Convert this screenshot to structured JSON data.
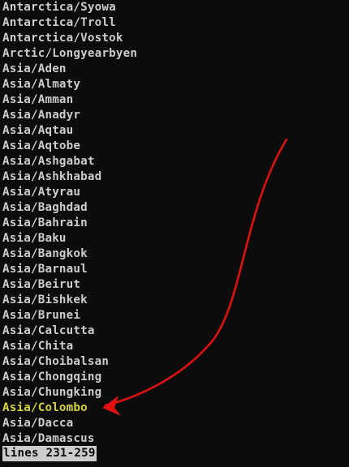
{
  "terminal": {
    "lines": [
      "Antarctica/Syowa",
      "Antarctica/Troll",
      "Antarctica/Vostok",
      "Arctic/Longyearbyen",
      "Asia/Aden",
      "Asia/Almaty",
      "Asia/Amman",
      "Asia/Anadyr",
      "Asia/Aqtau",
      "Asia/Aqtobe",
      "Asia/Ashgabat",
      "Asia/Ashkhabad",
      "Asia/Atyrau",
      "Asia/Baghdad",
      "Asia/Bahrain",
      "Asia/Baku",
      "Asia/Bangkok",
      "Asia/Barnaul",
      "Asia/Beirut",
      "Asia/Bishkek",
      "Asia/Brunei",
      "Asia/Calcutta",
      "Asia/Chita",
      "Asia/Choibalsan",
      "Asia/Chongqing",
      "Asia/Chungking",
      "Asia/Colombo",
      "Asia/Dacca",
      "Asia/Damascus"
    ],
    "highlighted_line": "Asia/Colombo",
    "status": "lines 231-259"
  },
  "colors": {
    "background": "#0c0c0c",
    "text": "#cccccc",
    "highlight": "#d6d23a",
    "annotation_arrow": "#e01010"
  }
}
